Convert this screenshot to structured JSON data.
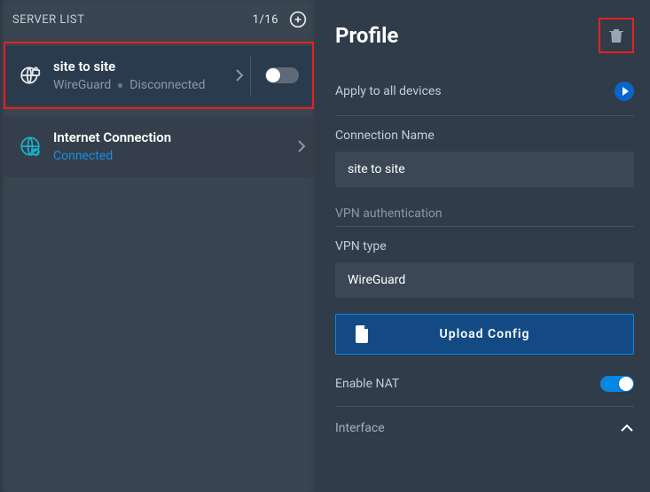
{
  "sidebar": {
    "title": "SERVER LIST",
    "count": "1/16",
    "items": [
      {
        "title": "site to site",
        "protocol": "WireGuard",
        "status": "Disconnected",
        "connected": false,
        "toggle": false,
        "highlighted": true
      },
      {
        "title": "Internet Connection",
        "status": "Connected",
        "connected": true
      }
    ]
  },
  "profile": {
    "title": "Profile",
    "apply_all_label": "Apply to all devices",
    "connection_name_label": "Connection Name",
    "connection_name_value": "site to site",
    "vpn_auth_label": "VPN authentication",
    "vpn_type_label": "VPN type",
    "vpn_type_value": "WireGuard",
    "upload_label": "Upload Config",
    "enable_nat_label": "Enable NAT",
    "enable_nat_value": true,
    "interface_label": "Interface"
  }
}
